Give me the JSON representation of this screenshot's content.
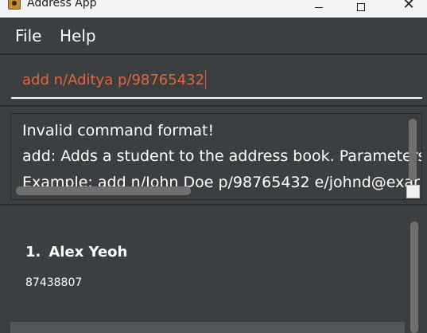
{
  "window": {
    "title": "Address App",
    "minimize_icon": "minimize-icon",
    "maximize_icon": "maximize-icon",
    "close_icon": "close-icon",
    "close_glyph": "✕"
  },
  "menu": {
    "items": [
      {
        "label": "File"
      },
      {
        "label": "Help"
      }
    ]
  },
  "command_box": {
    "value": "add n/Aditya p/98765432",
    "text_color": "#e4643c"
  },
  "result_display": {
    "lines": [
      "Invalid command format!",
      "add: Adds a student to the address book. Parameters",
      "Example: add n/John Doe p/98765432 e/johnd@exar"
    ]
  },
  "person_list": {
    "cards": [
      {
        "index": "1.",
        "name": "Alex Yeoh",
        "phone": "87438807"
      }
    ]
  },
  "colors": {
    "background": "#3c3f41",
    "text": "#ffffff",
    "accent": "#e4643c"
  }
}
